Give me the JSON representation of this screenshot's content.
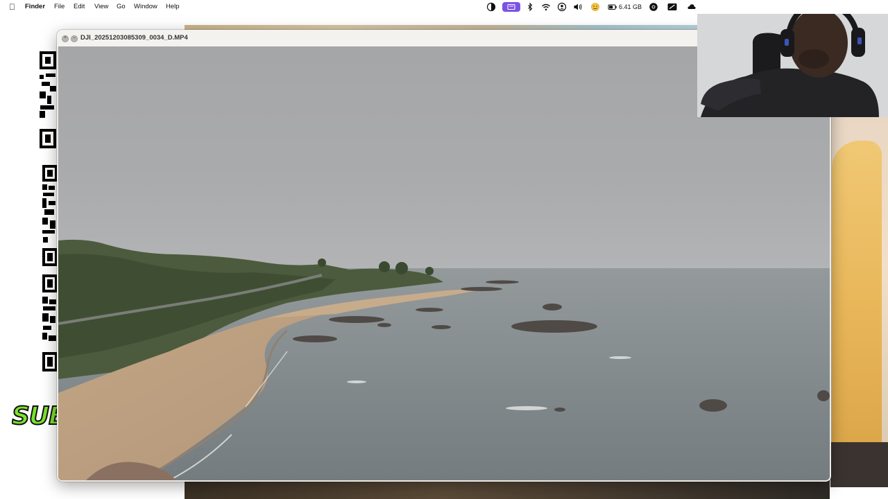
{
  "menubar": {
    "app_name": "Finder",
    "menus": [
      "File",
      "Edit",
      "View",
      "Go",
      "Window",
      "Help"
    ],
    "status_icons": [
      "theme-icon",
      "display-icon",
      "bluetooth-icon",
      "wifi-icon",
      "user-icon",
      "volume-icon",
      "emoji-icon",
      "battery-icon",
      "chrome-icon",
      "screen-icon",
      "cloud-icon"
    ],
    "storage_text": "6.41 GB"
  },
  "player": {
    "title": "DJI_20251203085309_0034_D.MP4",
    "controls": [
      "close-icon",
      "minimize-icon"
    ]
  },
  "video": {
    "scene_icon": "coastline-video-frame"
  },
  "overlay": {
    "badge_text": "SUB",
    "webcam": "webcam-feed"
  },
  "colors": {
    "menubar_bg": "#ffffff",
    "accent_badge": "#7be22a",
    "sky": "#9fa0a2",
    "sea": "#7f8789",
    "sand": "#c9ad8c",
    "vegetation": "#4c5b3d"
  }
}
